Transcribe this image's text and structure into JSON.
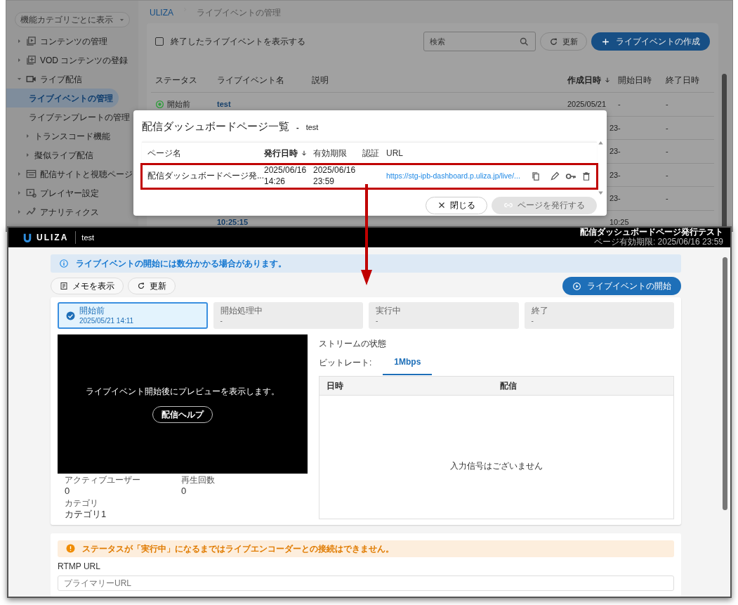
{
  "back_screen": {
    "sidebar": {
      "view_select": "機能カテゴリごとに表示",
      "items": [
        {
          "label": "コンテンツの管理",
          "expanded": false,
          "selected": false
        },
        {
          "label": "VOD コンテンツの登録",
          "expanded": false,
          "selected": false
        },
        {
          "label": "ライブ配信",
          "expanded": true,
          "selected": false,
          "children": [
            {
              "label": "ライブイベントの管理",
              "selected": true
            },
            {
              "label": "ライブテンプレートの管理",
              "selected": false
            },
            {
              "label": "トランスコード機能",
              "expanded": false,
              "selected": false
            },
            {
              "label": "擬似ライブ配信",
              "expanded": false,
              "selected": false
            }
          ]
        },
        {
          "label": "配信サイトと視聴ページ",
          "expanded": false,
          "selected": false
        },
        {
          "label": "プレイヤー設定",
          "expanded": false,
          "selected": false
        },
        {
          "label": "アナリティクス",
          "expanded": false,
          "selected": false
        }
      ]
    },
    "breadcrumb": [
      "ULIZA",
      "ライブイベントの管理"
    ],
    "show_ended": {
      "label": "終了したライブイベントを表示する",
      "checked": false
    },
    "search": {
      "placeholder": "検索"
    },
    "refresh_button": "更新",
    "create_button": "ライブイベントの作成",
    "table": {
      "columns": [
        {
          "label": "ステータス",
          "sorted": false
        },
        {
          "label": "ライブイベント名",
          "sorted": false
        },
        {
          "label": "説明",
          "sorted": false
        },
        {
          "label": "作成日時",
          "sorted": true
        },
        {
          "label": "開始日時",
          "sorted": false
        },
        {
          "label": "終了日時",
          "sorted": false
        }
      ],
      "rows": [
        {
          "status": "開始前",
          "name": "test",
          "created": "2025/05/21",
          "start": "-",
          "end": "-"
        },
        {
          "created": "23",
          "start": "-",
          "end": "-"
        },
        {
          "created": "23",
          "start": "-",
          "end": "-"
        },
        {
          "created": "23",
          "start": "-",
          "end": "-"
        },
        {
          "created": "23",
          "start": "-",
          "end": "-"
        },
        {
          "name": "10:25:15",
          "created": "10:25"
        }
      ]
    },
    "dialog": {
      "title": "配信ダッシュボードページ一覧",
      "separator": "-",
      "event": "test",
      "columns": [
        {
          "label": "ページ名",
          "sorted": false
        },
        {
          "label": "発行日時",
          "sorted": true
        },
        {
          "label": "有効期限",
          "sorted": false
        },
        {
          "label": "認証",
          "sorted": false
        },
        {
          "label": "URL",
          "sorted": false
        }
      ],
      "rows": [
        {
          "name": "配信ダッシュボードページ発...",
          "issued": [
            "2025/06/16",
            "14:26"
          ],
          "expires": [
            "2025/06/16",
            "23:59"
          ],
          "url": "https://stg-ipb-dashboard.p.uliza.jp/live/...",
          "highlighted": true
        }
      ],
      "close_button": "閉じる",
      "issue_button": {
        "label": "ページを発行する",
        "disabled": true
      }
    }
  },
  "front_screen": {
    "header": {
      "logo": "ULIZA",
      "event": "test",
      "page_title": "配信ダッシュボードページ発行テスト",
      "expiry": "ページ有効期限: 2025/06/16 23:59"
    },
    "info_alert": "ライブイベントの開始には数分かかる場合があります。",
    "memo_button": "メモを表示",
    "refresh_button": "更新",
    "start_button": "ライブイベントの開始",
    "steps": [
      {
        "label": "開始前",
        "time": "2025/05/21 14:11",
        "selected": true
      },
      {
        "label": "開始処理中",
        "time": "-",
        "selected": false
      },
      {
        "label": "実行中",
        "time": "-",
        "selected": false
      },
      {
        "label": "終了",
        "time": "-",
        "selected": false
      }
    ],
    "preview": {
      "message": "ライブイベント開始後にプレビューを表示します。",
      "help_button": "配信ヘルプ"
    },
    "stats": [
      {
        "label": "アクティブユーザー",
        "value": "0"
      },
      {
        "label": "再生回数",
        "value": "0"
      },
      {
        "label": "カテゴリ",
        "value": "カテゴリ1"
      }
    ],
    "stream": {
      "title": "ストリームの状態",
      "bitrate_label": "ビットレート:",
      "tabs": [
        {
          "label": "1Mbps",
          "selected": true
        }
      ],
      "columns": [
        "日時",
        "配信"
      ],
      "empty": "入力信号はございません"
    },
    "warning_alert": "ステータスが「実行中」になるまではライブエンコーダーとの接続はできません。",
    "rtmp": {
      "label": "RTMP URL",
      "placeholder": "プライマリーURL"
    }
  }
}
